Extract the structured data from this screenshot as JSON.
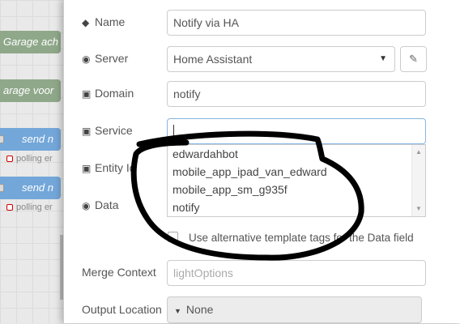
{
  "canvas": {
    "nodes": [
      {
        "label": "Garage ach"
      },
      {
        "label": "arage voor"
      },
      {
        "label": "send n",
        "status": "polling er"
      },
      {
        "label": "send n",
        "status": "polling er"
      }
    ]
  },
  "form": {
    "name": {
      "label": "Name",
      "value": "Notify via HA"
    },
    "server": {
      "label": "Server",
      "value": "Home Assistant"
    },
    "domain": {
      "label": "Domain",
      "value": "notify"
    },
    "service": {
      "label": "Service",
      "value": ""
    },
    "entity_id": {
      "label": "Entity Id"
    },
    "data": {
      "label": "Data"
    },
    "service_options": [
      "edwardahbot",
      "mobile_app_ipad_van_edward",
      "mobile_app_sm_g935f",
      "notify"
    ],
    "alt_template": {
      "label": "Use alternative template tags for the Data field",
      "checked": false
    },
    "merge_context": {
      "label": "Merge Context",
      "placeholder": "lightOptions"
    },
    "output_location": {
      "label": "Output Location",
      "value": "None"
    }
  },
  "icons": {
    "name": "tag-icon",
    "server": "dot-circle-icon",
    "domain": "cube-icon",
    "service": "cube-icon",
    "entity_id": "cube-icon",
    "data": "dot-circle-icon",
    "edit": "pencil-icon"
  },
  "colors": {
    "focus_border": "#85b5e4",
    "flow_green": "#8fa88a",
    "flow_blue": "#74a7d9",
    "scribble": "#000000"
  }
}
